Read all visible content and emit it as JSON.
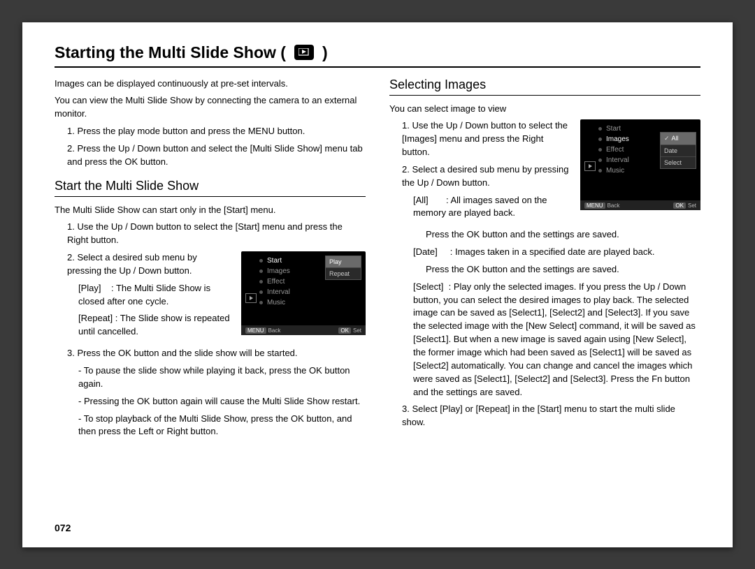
{
  "title_prefix": "Starting the Multi Slide Show (",
  "title_suffix": ")",
  "intro": {
    "line1": "Images can be displayed continuously at pre-set intervals.",
    "line2": "You can view the Multi Slide Show by connecting the camera to an external monitor.",
    "step1": "1. Press the play mode button and press the MENU button.",
    "step2": "2. Press the Up / Down button and select the [Multi Slide Show] menu tab and press the OK button."
  },
  "left": {
    "heading": "Start the Multi Slide Show",
    "p1": "The Multi Slide Show can start only in the [Start] menu.",
    "s1": "1. Use the Up / Down button to select the [Start] menu and press the Right button.",
    "s2": "2. Select a desired sub menu by pressing the Up / Down button.",
    "play_label": "[Play]",
    "play_desc": ": The Multi Slide Show is closed after one cycle.",
    "repeat_label": "[Repeat]",
    "repeat_desc": ": The Slide show is repeated until cancelled.",
    "s3": "3. Press the OK button and the slide show will be started.",
    "b1": "- To pause the slide show while playing it back, press the OK button again.",
    "b2": "- Pressing the OK button again will cause the Multi Slide Show restart.",
    "b3": "- To stop playback of the Multi Slide Show, press the OK button, and then press the Left or Right button."
  },
  "right": {
    "heading": "Selecting Images",
    "p1": "You can select image to view",
    "s1": "1. Use the Up / Down button to select the [Images] menu and press the Right button.",
    "s2": "2. Select a desired sub menu by pressing the Up / Down button.",
    "all_label": "[All]",
    "all_desc1": ": All images saved on the memory are played back.",
    "all_desc2": "Press the OK button and the settings are saved.",
    "date_label": "[Date]",
    "date_desc1": ": Images taken in a specified date are played back.",
    "date_desc2": "Press the OK button and the settings are saved.",
    "select_label": "[Select]",
    "select_desc": ": Play only the selected images. If you press the Up / Down button, you can select the desired images to play back. The selected image can be saved as [Select1], [Select2] and [Select3]. If you save the selected image with the [New Select] command, it will be saved as [Select1]. But when a new image is saved again using [New Select], the former image which had been saved as [Select1] will be saved as [Select2] automatically. You can change and cancel the images which were saved as [Select1], [Select2] and [Select3]. Press the Fn button and the settings are saved.",
    "s3": "3. Select [Play] or [Repeat] in the [Start] menu to start the multi slide show."
  },
  "lcd1": {
    "menu": [
      "Start",
      "Images",
      "Effect",
      "Interval",
      "Music"
    ],
    "sub": [
      "Play",
      "Repeat"
    ],
    "foot_left": "Back",
    "foot_left_tag": "MENU",
    "foot_right": "Set",
    "foot_right_tag": "OK"
  },
  "lcd2": {
    "menu": [
      "Start",
      "Images",
      "Effect",
      "Interval",
      "Music"
    ],
    "sub": [
      "All",
      "Date",
      "Select"
    ],
    "foot_left": "Back",
    "foot_left_tag": "MENU",
    "foot_right": "Set",
    "foot_right_tag": "OK"
  },
  "page_number": "072"
}
